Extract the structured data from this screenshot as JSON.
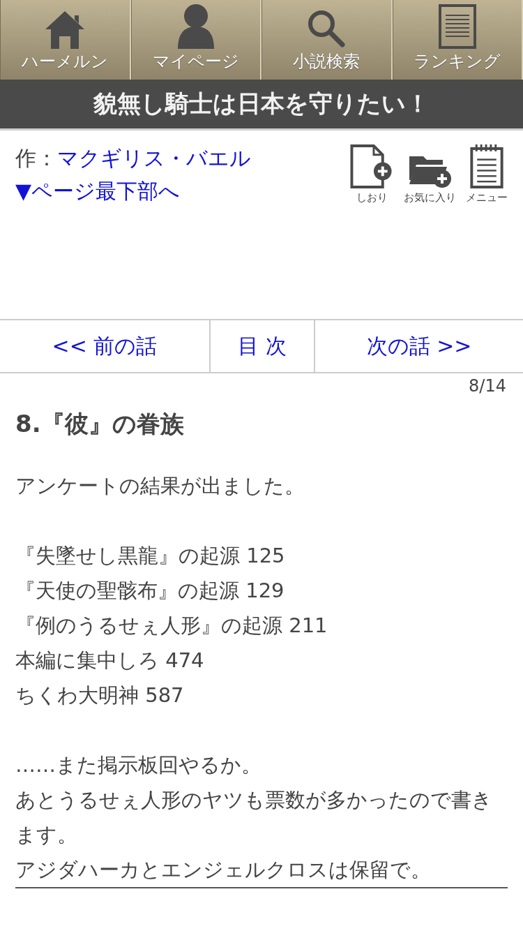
{
  "nav": [
    {
      "kind": "home",
      "label": "ハーメルン"
    },
    {
      "kind": "person",
      "label": "マイページ"
    },
    {
      "kind": "search",
      "label": "小説検索"
    },
    {
      "kind": "document",
      "label": "ランキング"
    }
  ],
  "title": "貌無し騎士は日本を守りたい！",
  "author": {
    "prefix": "作：",
    "name": "マクギリス・バエル"
  },
  "jump_link": "▼ページ最下部へ",
  "actions": [
    {
      "kind": "bookmark",
      "label": "しおり"
    },
    {
      "kind": "favorite",
      "label": "お気に入り"
    },
    {
      "kind": "menu",
      "label": "メニュー"
    }
  ],
  "pager": {
    "prev": "<< 前の話",
    "toc": "目 次",
    "next": "次の話 >>"
  },
  "page_count": "8/14",
  "chapter_title": "8.『彼』の眷族",
  "blocks": [
    {
      "lines": [
        "アンケートの結果が出ました。"
      ]
    },
    {
      "lines": [
        "『失墜せし黒龍』の起源 125",
        "『天使の聖骸布』の起源 129",
        "『例のうるせぇ人形』の起源 211",
        "本編に集中しろ 474",
        "ちくわ大明神 587"
      ]
    },
    {
      "lines": [
        "……また掲示板回やるか。",
        "あとうるせぇ人形のヤツも票数が多かったので書きます。",
        "アジダハーカとエンジェルクロスは保留で。"
      ]
    }
  ]
}
